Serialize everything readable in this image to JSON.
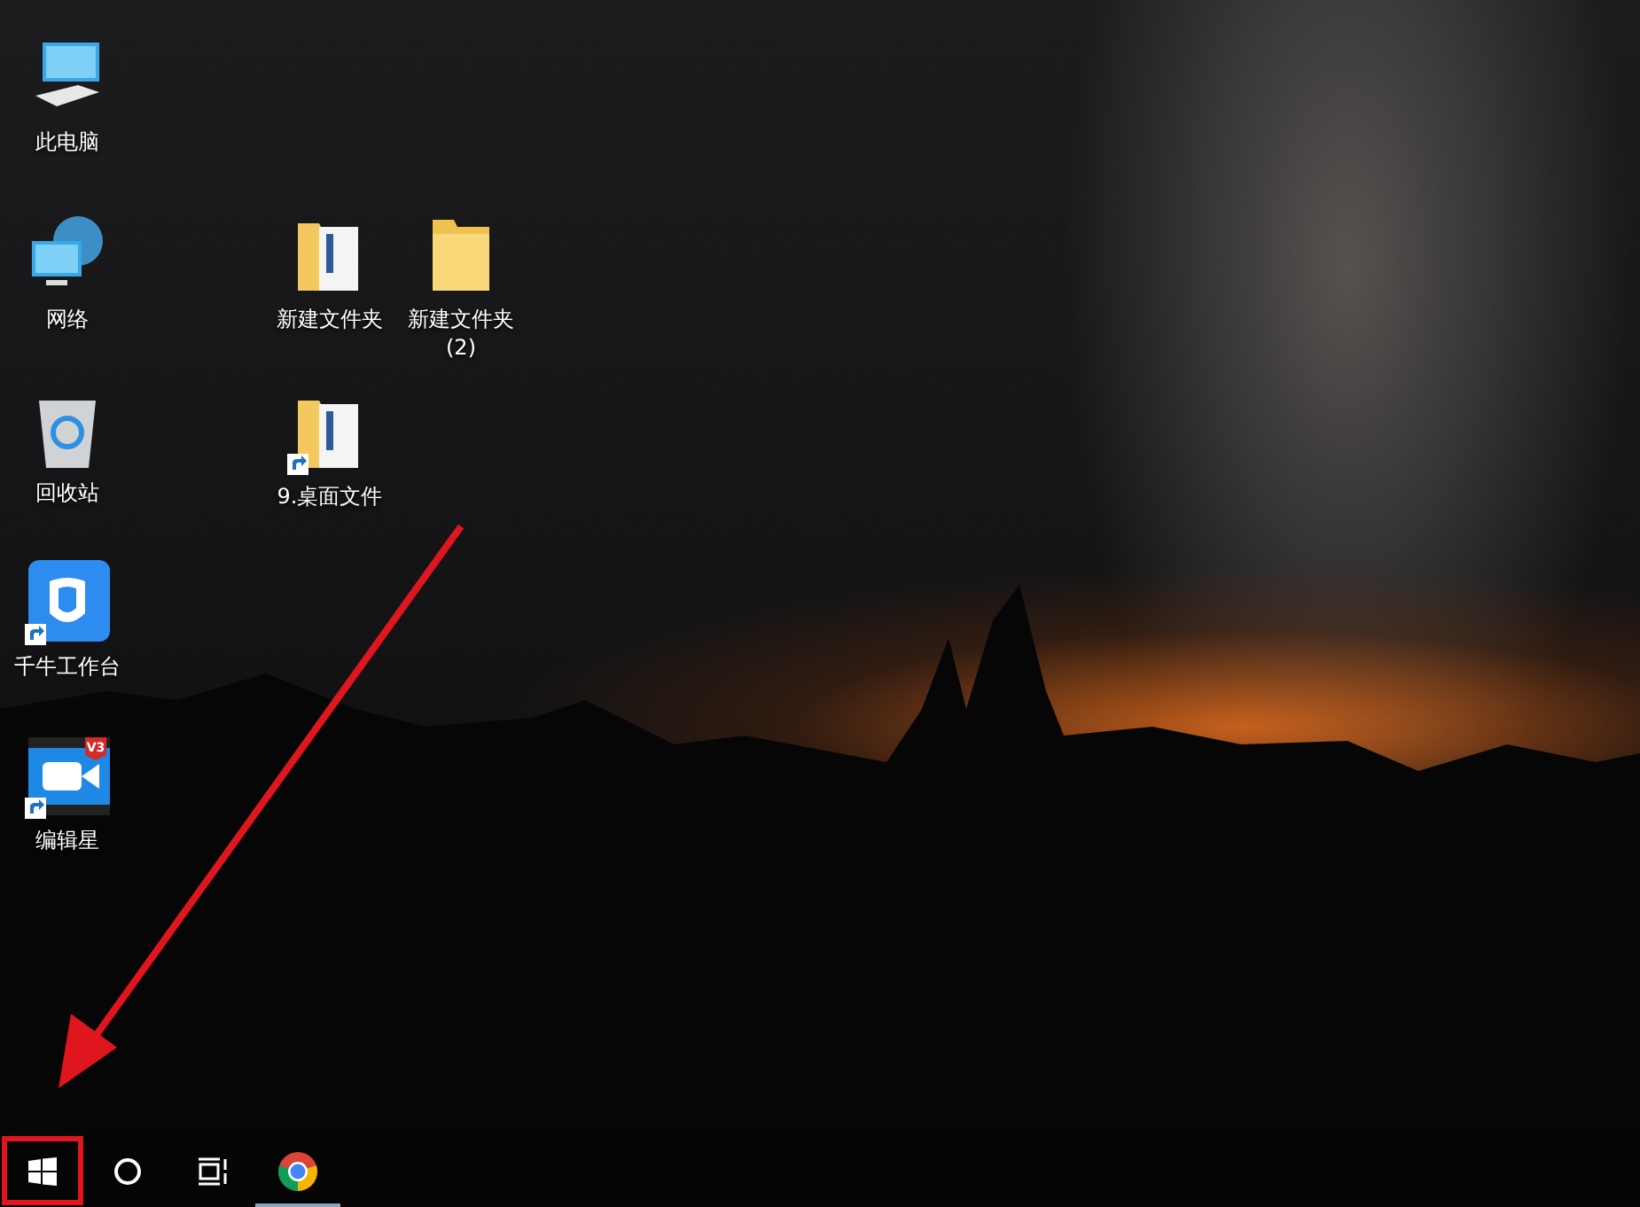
{
  "desktop_icons": [
    {
      "kind": "computer",
      "label": "此电脑",
      "shortcut": false
    },
    {
      "kind": "network",
      "label": "网络",
      "shortcut": false
    },
    {
      "kind": "recycle",
      "label": "回收站",
      "shortcut": false
    },
    {
      "kind": "app-cow",
      "label": "千牛工作台",
      "shortcut": true
    },
    {
      "kind": "app-video",
      "label": "编辑星",
      "shortcut": true,
      "badge": "V3"
    },
    {
      "kind": "folder-docs",
      "label": "新建文件夹",
      "shortcut": false
    },
    {
      "kind": "folder-docs",
      "label": "9.桌面文件",
      "shortcut": true
    },
    {
      "kind": "folder",
      "label": "新建文件夹 (2)",
      "shortcut": false
    }
  ],
  "taskbar": {
    "items": [
      {
        "kind": "start",
        "highlighted": true,
        "running": false
      },
      {
        "kind": "search",
        "highlighted": false,
        "running": false
      },
      {
        "kind": "task-view",
        "highlighted": false,
        "running": false
      },
      {
        "kind": "chrome",
        "highlighted": false,
        "running": true
      }
    ]
  },
  "annotation": {
    "arrow_to_start": true
  }
}
